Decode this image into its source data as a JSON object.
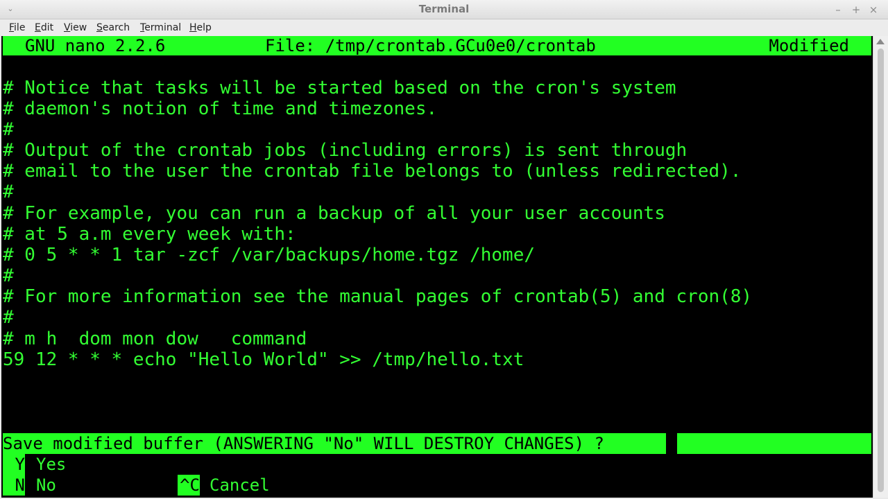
{
  "window": {
    "title": "Terminal",
    "menu_arrow": "⌄",
    "minimize": "–",
    "maximize": "+",
    "close": "×"
  },
  "menu": {
    "items": [
      {
        "mnemonic": "F",
        "rest": "ile"
      },
      {
        "mnemonic": "E",
        "rest": "dit"
      },
      {
        "mnemonic": "V",
        "rest": "iew"
      },
      {
        "mnemonic": "S",
        "rest": "earch"
      },
      {
        "mnemonic": "T",
        "rest": "erminal"
      },
      {
        "mnemonic": "H",
        "rest": "elp"
      }
    ]
  },
  "nano": {
    "version": "GNU nano 2.2.6",
    "file": "File: /tmp/crontab.GCu0e0/crontab",
    "status": "Modified"
  },
  "lines": [
    "# Notice that tasks will be started based on the cron's system",
    "# daemon's notion of time and timezones.",
    "#",
    "# Output of the crontab jobs (including errors) is sent through",
    "# email to the user the crontab file belongs to (unless redirected).",
    "#",
    "# For example, you can run a backup of all your user accounts",
    "# at 5 a.m every week with:",
    "# 0 5 * * 1 tar -zcf /var/backups/home.tgz /home/",
    "#",
    "# For more information see the manual pages of crontab(5) and cron(8)",
    "#",
    "# m h  dom mon dow   command",
    "59 12 * * * echo \"Hello World\" >> /tmp/hello.txt"
  ],
  "prompt": "Save modified buffer (ANSWERING \"No\" WILL DESTROY CHANGES) ?",
  "shortcuts": {
    "yes_key": " Y",
    "yes_label": "Yes",
    "no_key": " N",
    "no_label": "No",
    "cancel_key": "^C",
    "cancel_label": "Cancel"
  },
  "colors": {
    "terminal_bg": "#000000",
    "terminal_fg": "#33ff33",
    "inverse_bg": "#22ff22"
  }
}
